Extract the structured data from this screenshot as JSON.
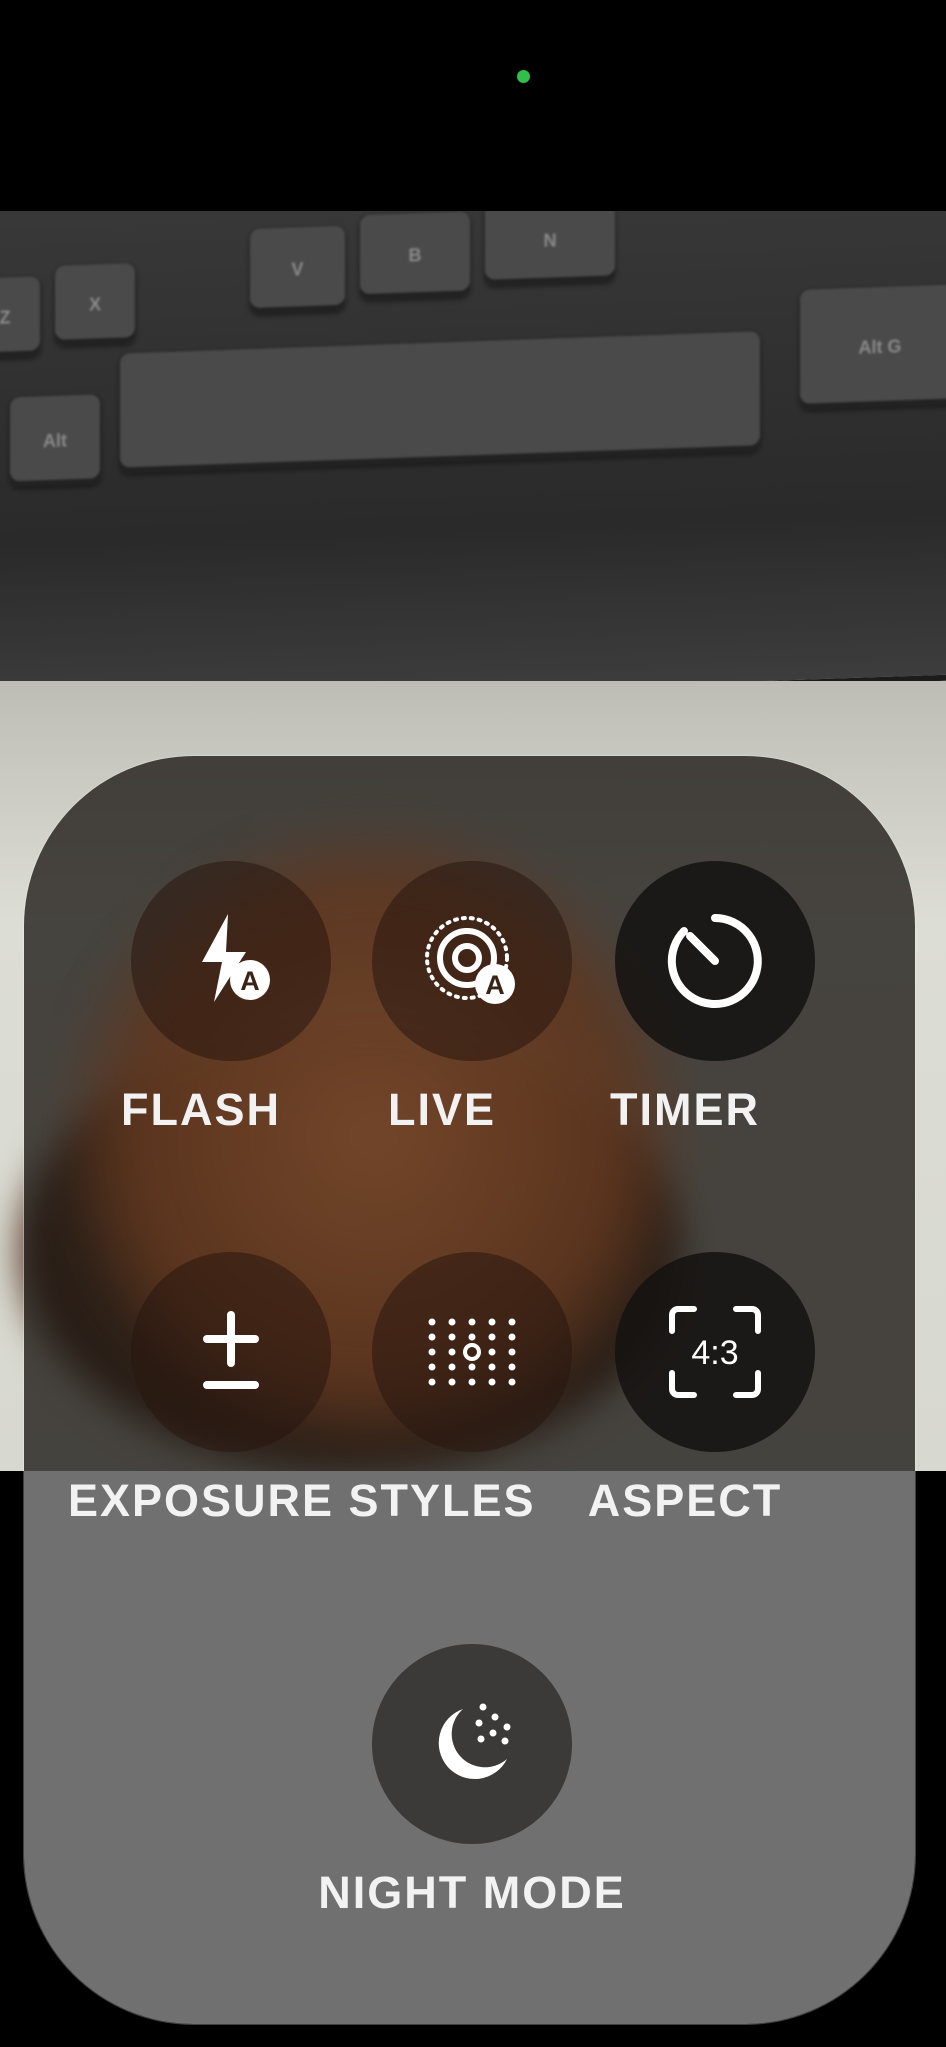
{
  "controls": {
    "flash": {
      "label": "FLASH",
      "icon": "flash-auto-icon"
    },
    "live": {
      "label": "LIVE",
      "icon": "live-auto-icon"
    },
    "timer": {
      "label": "TIMER",
      "icon": "timer-icon"
    },
    "exposure": {
      "label": "EXPOSURE",
      "icon": "plus-minus-icon"
    },
    "styles": {
      "label": "STYLES",
      "icon": "styles-grid-icon"
    },
    "aspect": {
      "label": "ASPECT",
      "icon": "aspect-ratio-icon",
      "ratio": "4:3"
    },
    "night_mode": {
      "label": "NIGHT MODE",
      "icon": "moon-icon"
    }
  },
  "flash_badge": "A",
  "live_badge": "A",
  "keyboard_keys": [
    "Z",
    "X",
    "V",
    "B",
    "N",
    "Alt",
    "Alt G"
  ],
  "colors": {
    "indicator": "#2fbf4a",
    "label": "#f2f2f2"
  }
}
